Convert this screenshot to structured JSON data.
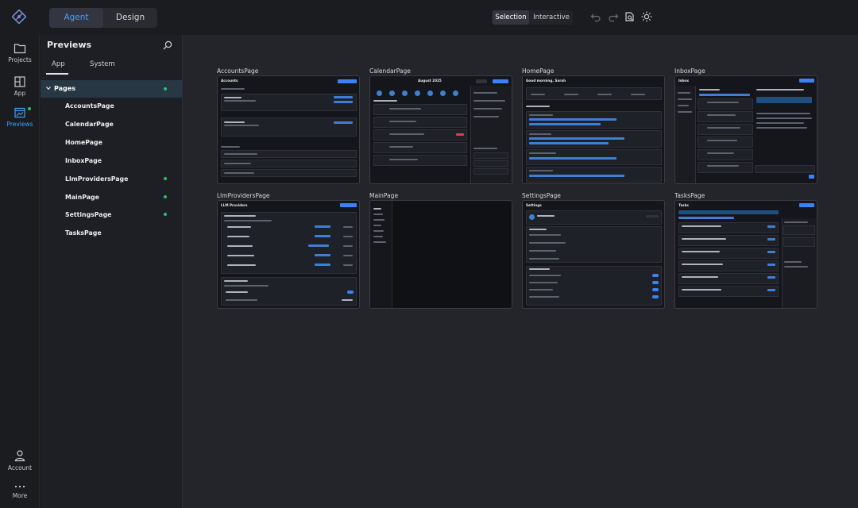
{
  "topbar": {
    "modes": [
      {
        "label": "Agent",
        "active": true
      },
      {
        "label": "Design",
        "active": false
      }
    ],
    "view_modes": [
      {
        "label": "Selection",
        "active": true
      },
      {
        "label": "Interactive",
        "active": false
      }
    ],
    "actions": [
      "undo-icon",
      "redo-icon",
      "snapshot-icon",
      "theme-sun-icon"
    ]
  },
  "rail": {
    "items": [
      {
        "label": "Projects",
        "icon": "folder-icon",
        "active": false
      },
      {
        "label": "App",
        "icon": "app-grid-icon",
        "active": false
      },
      {
        "label": "Previews",
        "icon": "previews-icon",
        "active": true,
        "badge": "green"
      }
    ],
    "bottom": [
      {
        "label": "Account",
        "icon": "user-icon"
      },
      {
        "label": "More",
        "icon": "more-dots-icon"
      }
    ]
  },
  "sidebar": {
    "title": "Previews",
    "tabs": [
      {
        "label": "App",
        "active": true
      },
      {
        "label": "System",
        "active": false
      }
    ],
    "group": {
      "label": "Pages",
      "status": "green"
    },
    "pages": [
      {
        "label": "AccountsPage",
        "dot": false
      },
      {
        "label": "CalendarPage",
        "dot": false
      },
      {
        "label": "HomePage",
        "dot": false
      },
      {
        "label": "InboxPage",
        "dot": false
      },
      {
        "label": "LlmProvidersPage",
        "dot": true
      },
      {
        "label": "MainPage",
        "dot": true
      },
      {
        "label": "SettingsPage",
        "dot": true
      },
      {
        "label": "TasksPage",
        "dot": false
      }
    ]
  },
  "previews": [
    {
      "label": "AccountsPage",
      "thumb_title": "Accounts"
    },
    {
      "label": "CalendarPage",
      "thumb_title": "August 2025"
    },
    {
      "label": "HomePage",
      "thumb_title": "Good morning, Sarah"
    },
    {
      "label": "InboxPage",
      "thumb_title": "Inbox"
    },
    {
      "label": "LlmProvidersPage",
      "thumb_title": "LLM Providers"
    },
    {
      "label": "MainPage",
      "thumb_title": ""
    },
    {
      "label": "SettingsPage",
      "thumb_title": "Settings"
    },
    {
      "label": "TasksPage",
      "thumb_title": "Tasks"
    }
  ],
  "colors": {
    "accent": "#3fa1ff",
    "status_green": "#25c26e",
    "selected_group_bg": "#283744"
  }
}
